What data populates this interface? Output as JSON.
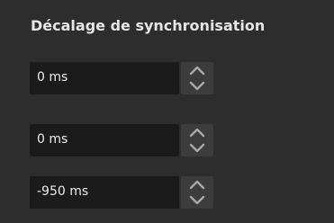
{
  "panel": {
    "title": "Décalage de synchronisation"
  },
  "offsets": [
    {
      "value": "0 ms"
    },
    {
      "value": "0 ms"
    },
    {
      "value": "-950 ms"
    }
  ],
  "icons": {
    "up": "chevron-up-icon",
    "down": "chevron-down-icon"
  },
  "colors": {
    "background": "#2d2d2d",
    "field": "#1b1b1b",
    "buttons": "#3c3c3c",
    "text": "#ececec",
    "icon": "#a8a8a8"
  }
}
